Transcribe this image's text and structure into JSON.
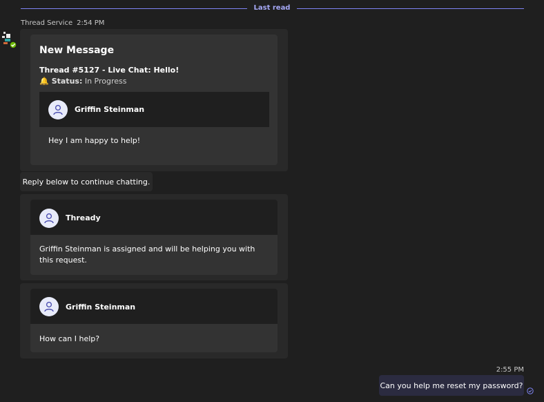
{
  "divider": {
    "label": "Last read"
  },
  "sender": {
    "name": "Thread Service",
    "time": "2:54 PM"
  },
  "new_message_card": {
    "title": "New Message",
    "thread_line": "Thread #5127 - Live Chat: Hello!",
    "status_label": "Status:",
    "status_value": "In Progress",
    "agent_name": "Griffin Steinman",
    "body": "Hey I am happy to help!"
  },
  "reply_prompt": "Reply below to continue chatting.",
  "assigned_card": {
    "name": "Thready",
    "body": "Griffin Steinman is assigned and will be helping you with this request."
  },
  "help_card": {
    "name": "Griffin Steinman",
    "body": "How can I help?"
  },
  "my_message": {
    "time": "2:55 PM",
    "text": "Can you help me reset my password?"
  },
  "colors": {
    "background": "#1f1f1f",
    "accent": "#7f85f5",
    "card": "#333333",
    "my_bubble": "#2b2b40",
    "status_green": "#6bb700"
  }
}
